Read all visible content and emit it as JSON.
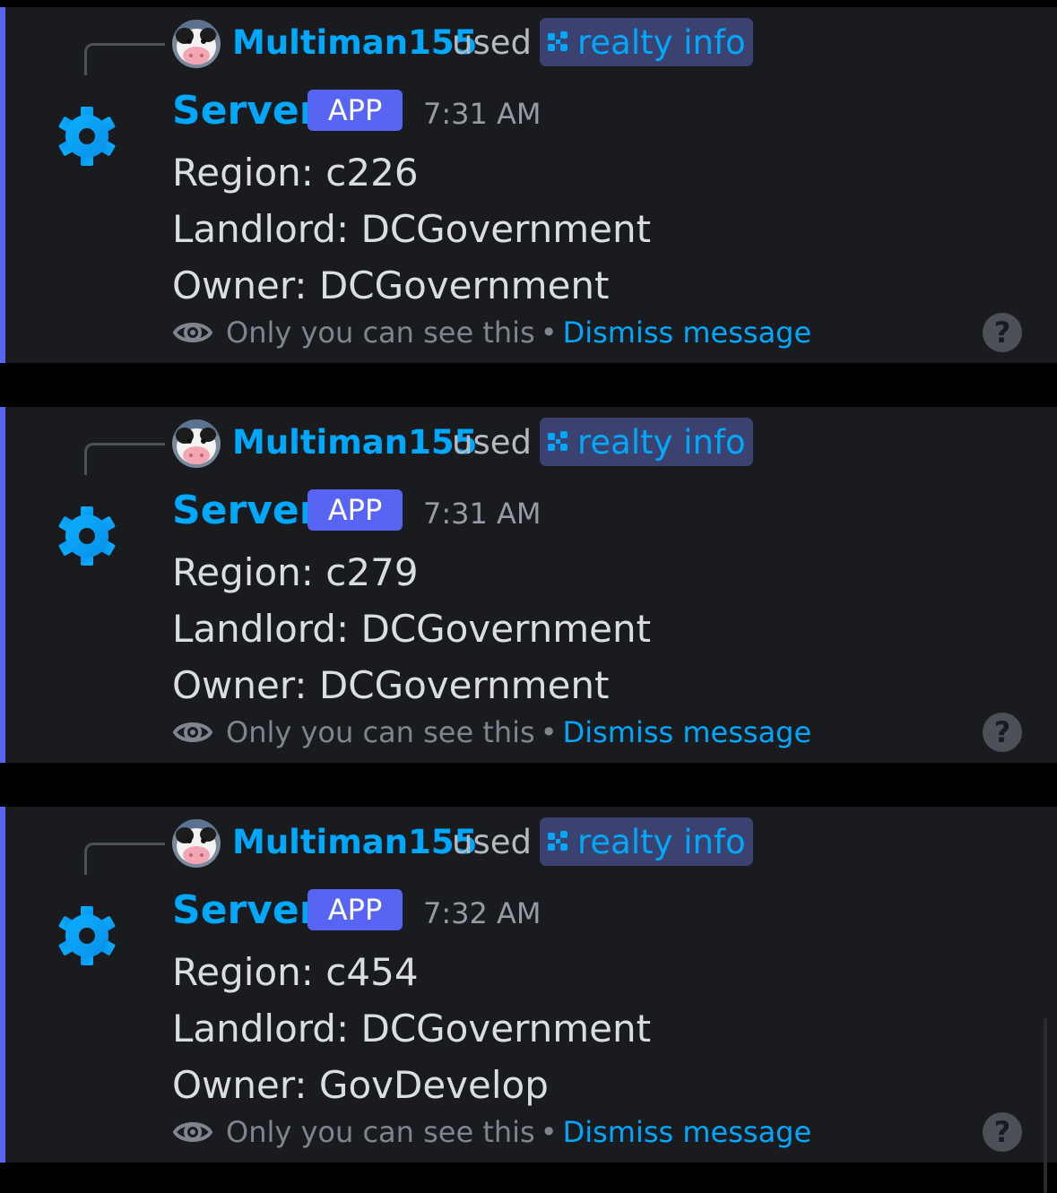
{
  "colors": {
    "accent": "#5865f2",
    "link": "#00a8fc",
    "background": "#1a1b1f",
    "text": "#dbdee1",
    "muted": "#80848e"
  },
  "messages": [
    {
      "reply_user": "Multiman155",
      "reply_verb": "used",
      "command": "realty info",
      "author": "Server",
      "badge": "APP",
      "time": "7:31 AM",
      "lines": [
        "Region: c226",
        "Landlord: DCGovernment",
        "Owner: DCGovernment"
      ],
      "ephemeral_text": "Only you can see this",
      "separator": "•",
      "dismiss": "Dismiss message",
      "help": "?"
    },
    {
      "reply_user": "Multiman155",
      "reply_verb": "used",
      "command": "realty info",
      "author": "Server",
      "badge": "APP",
      "time": "7:31 AM",
      "lines": [
        "Region: c279",
        "Landlord: DCGovernment",
        "Owner: DCGovernment"
      ],
      "ephemeral_text": "Only you can see this",
      "separator": "•",
      "dismiss": "Dismiss message",
      "help": "?"
    },
    {
      "reply_user": "Multiman155",
      "reply_verb": "used",
      "command": "realty info",
      "author": "Server",
      "badge": "APP",
      "time": "7:32 AM",
      "lines": [
        "Region: c454",
        "Landlord: DCGovernment",
        "Owner: GovDevelop"
      ],
      "ephemeral_text": "Only you can see this",
      "separator": "•",
      "dismiss": "Dismiss message",
      "help": "?"
    }
  ]
}
